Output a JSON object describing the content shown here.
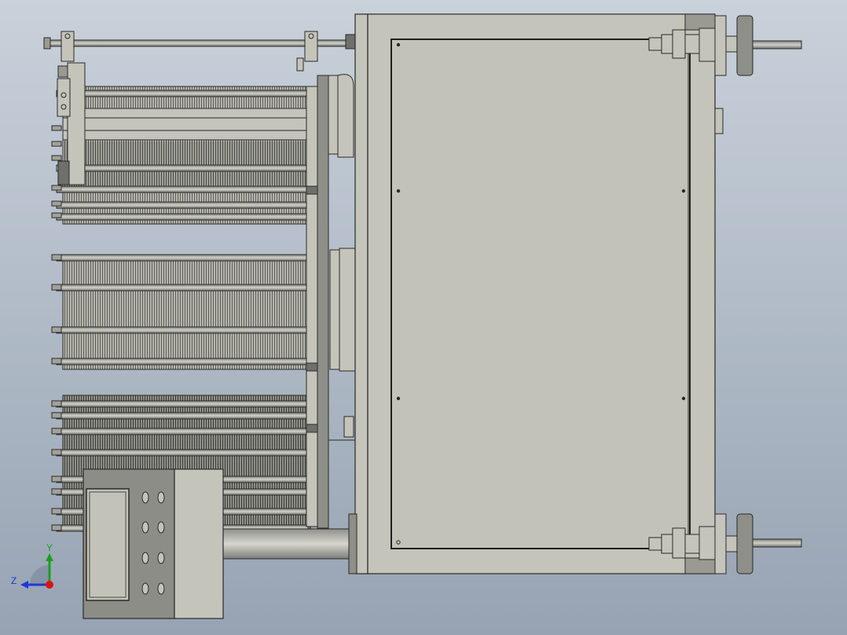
{
  "viewport": {
    "background_top": "#c9d1da",
    "background_bottom": "#97a3b3"
  },
  "model": {
    "part_color": "#c4c4ba",
    "fin_color": "#a9a9a2",
    "dark_color": "#6f706b",
    "outline_color": "#2a2a28"
  },
  "triad": {
    "y_label": "Y",
    "z_label": "Z",
    "y_color": "#19a019",
    "z_color": "#1a3bd6",
    "x_color": "#e01010"
  }
}
